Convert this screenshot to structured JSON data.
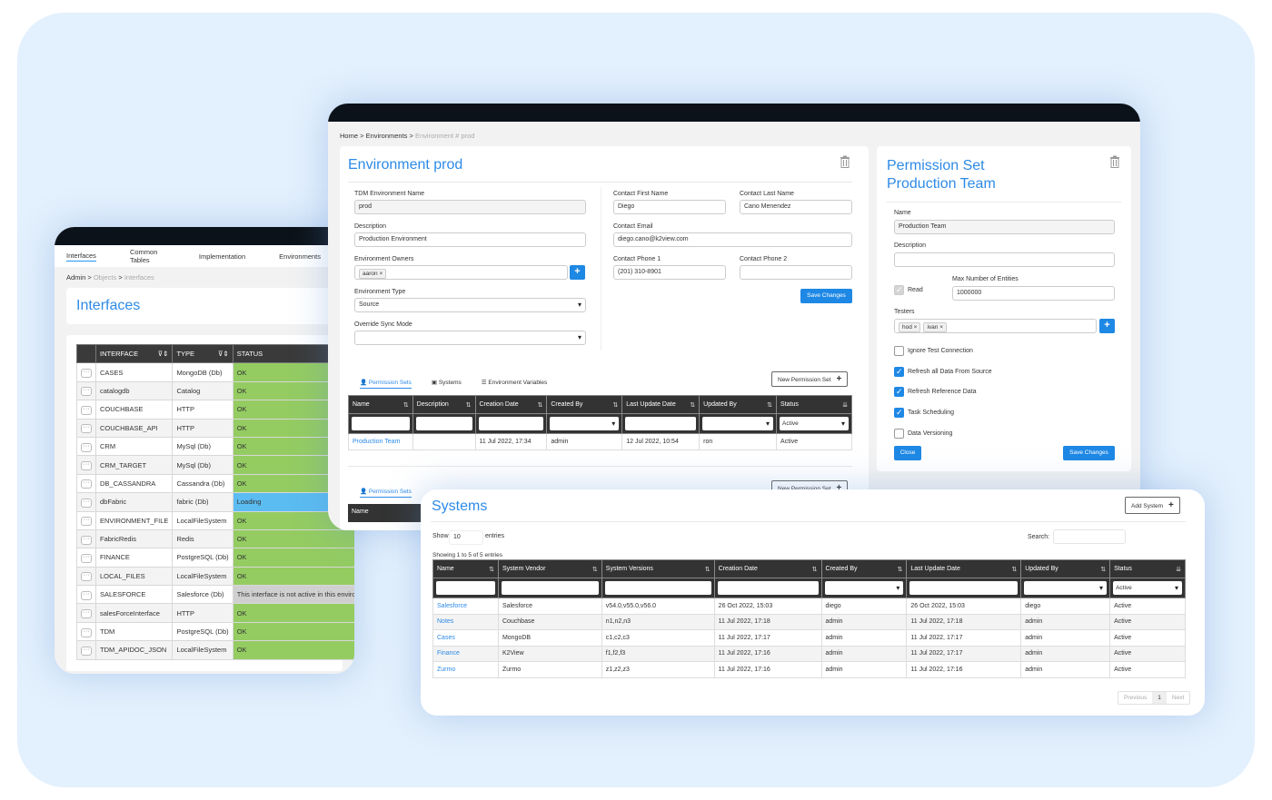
{
  "interfaces_window": {
    "nav_tabs": [
      "Interfaces",
      "Common Tables",
      "Implementation",
      "Environments"
    ],
    "active_tab": "Interfaces",
    "breadcrumb": [
      "Admin",
      "Objects",
      "Interfaces"
    ],
    "title": "Interfaces",
    "columns": [
      "INTERFACE",
      "TYPE",
      "STATUS"
    ],
    "rows": [
      {
        "interface": "CASES",
        "type": "MongoDB (Db)",
        "status": "OK",
        "state": "ok"
      },
      {
        "interface": "catalogdb",
        "type": "Catalog",
        "status": "OK",
        "state": "ok"
      },
      {
        "interface": "COUCHBASE",
        "type": "HTTP",
        "status": "OK",
        "state": "ok"
      },
      {
        "interface": "COUCHBASE_API",
        "type": "HTTP",
        "status": "OK",
        "state": "ok"
      },
      {
        "interface": "CRM",
        "type": "MySql (Db)",
        "status": "OK",
        "state": "ok"
      },
      {
        "interface": "CRM_TARGET",
        "type": "MySql (Db)",
        "status": "OK",
        "state": "ok"
      },
      {
        "interface": "DB_CASSANDRA",
        "type": "Cassandra (Db)",
        "status": "OK",
        "state": "ok"
      },
      {
        "interface": "dbFabric",
        "type": "fabric (Db)",
        "status": "Loading",
        "state": "loading"
      },
      {
        "interface": "ENVIRONMENT_FILE",
        "type": "LocalFileSystem",
        "status": "OK",
        "state": "ok"
      },
      {
        "interface": "FabricRedis",
        "type": "Redis",
        "status": "OK",
        "state": "ok"
      },
      {
        "interface": "FINANCE",
        "type": "PostgreSQL (Db)",
        "status": "OK",
        "state": "ok"
      },
      {
        "interface": "LOCAL_FILES",
        "type": "LocalFileSystem",
        "status": "OK",
        "state": "ok"
      },
      {
        "interface": "SALESFORCE",
        "type": "Salesforce (Db)",
        "status": "This interface is not active in this environment",
        "state": "inactive"
      },
      {
        "interface": "salesForceInterface",
        "type": "HTTP",
        "status": "OK",
        "state": "ok"
      },
      {
        "interface": "TDM",
        "type": "PostgreSQL (Db)",
        "status": "OK",
        "state": "ok"
      },
      {
        "interface": "TDM_APIDOC_JSON",
        "type": "LocalFileSystem",
        "status": "OK",
        "state": "ok"
      }
    ]
  },
  "environment_window": {
    "breadcrumb": [
      "Home",
      "Environments",
      "Environment # prod"
    ],
    "title": "Environment prod",
    "form": {
      "env_name_label": "TDM Environment Name",
      "env_name": "prod",
      "description_label": "Description",
      "description": "Production Environment",
      "owners_label": "Environment Owners",
      "owners": [
        "aaron"
      ],
      "type_label": "Environment Type",
      "type": "Source",
      "sync_label": "Override Sync Mode",
      "sync": "",
      "first_name_label": "Contact First Name",
      "first_name": "Diego",
      "last_name_label": "Contact Last Name",
      "last_name": "Cano Menendez",
      "email_label": "Contact Email",
      "email": "diego.cano@k2view.com",
      "phone1_label": "Contact Phone 1",
      "phone1": "(201) 310-8901",
      "phone2_label": "Contact Phone 2",
      "phone2": "",
      "save_label": "Save Changes"
    },
    "tabs": [
      "Permission Sets",
      "Systems",
      "Environment Variables"
    ],
    "active_tab": "Permission Sets",
    "new_permission_set_label": "New Permission Set",
    "ps_columns": [
      "Name",
      "Description",
      "Creation Date",
      "Created By",
      "Last Update Date",
      "Updated By",
      "Status"
    ],
    "ps_status_filter": "Active",
    "ps_rows": [
      {
        "name": "Production Team",
        "description": "",
        "creation_date": "11 Jul 2022, 17:34",
        "created_by": "admin",
        "last_update": "12 Jul 2022, 10:54",
        "updated_by": "ron",
        "status": "Active"
      }
    ]
  },
  "permission_set": {
    "title_line1": "Permission Set",
    "title_line2": "Production Team",
    "name_label": "Name",
    "name": "Production Team",
    "description_label": "Description",
    "description": "",
    "read_label": "Read",
    "read_checked": true,
    "max_entities_label": "Max Number of Entities",
    "max_entities": "1000000",
    "testers_label": "Testers",
    "testers": [
      "hod",
      "ivan"
    ],
    "options": [
      {
        "label": "Ignore Test Connection",
        "checked": false
      },
      {
        "label": "Refresh all Data From Source",
        "checked": true
      },
      {
        "label": "Refresh Reference Data",
        "checked": true
      },
      {
        "label": "Task Scheduling",
        "checked": true
      },
      {
        "label": "Data Versioning",
        "checked": false
      }
    ],
    "close_label": "Close",
    "save_label": "Save Changes"
  },
  "systems_window": {
    "title": "Systems",
    "add_label": "Add System",
    "show_label": "Show",
    "show_value": "10",
    "entries_label": "entries",
    "search_label": "Search:",
    "info": "Showing 1 to 5 of 5 entries",
    "columns": [
      "Name",
      "System Vendor",
      "System Versions",
      "Creation Date",
      "Created By",
      "Last Update Date",
      "Updated By",
      "Status"
    ],
    "status_filter": "Active",
    "rows": [
      {
        "name": "Salesforce",
        "vendor": "Salesforce",
        "versions": "v54.0,v55.0,v56.0",
        "created": "26 Oct 2022, 15:03",
        "created_by": "diego",
        "updated": "26 Oct 2022, 15:03",
        "updated_by": "diego",
        "status": "Active"
      },
      {
        "name": "Notes",
        "vendor": "Couchbase",
        "versions": "n1,n2,n3",
        "created": "11 Jul 2022, 17:18",
        "created_by": "admin",
        "updated": "11 Jul 2022, 17:18",
        "updated_by": "admin",
        "status": "Active"
      },
      {
        "name": "Cases",
        "vendor": "MongoDB",
        "versions": "c1,c2,c3",
        "created": "11 Jul 2022, 17:17",
        "created_by": "admin",
        "updated": "11 Jul 2022, 17:17",
        "updated_by": "admin",
        "status": "Active"
      },
      {
        "name": "Finance",
        "vendor": "K2View",
        "versions": "f1,f2,f3",
        "created": "11 Jul 2022, 17:16",
        "created_by": "admin",
        "updated": "11 Jul 2022, 17:17",
        "updated_by": "admin",
        "status": "Active"
      },
      {
        "name": "Zurmo",
        "vendor": "Zurmo",
        "versions": "z1,z2,z3",
        "created": "11 Jul 2022, 17:16",
        "created_by": "admin",
        "updated": "11 Jul 2022, 17:16",
        "updated_by": "admin",
        "status": "Active"
      }
    ],
    "pager": {
      "previous": "Previous",
      "page": "1",
      "next": "Next"
    }
  }
}
